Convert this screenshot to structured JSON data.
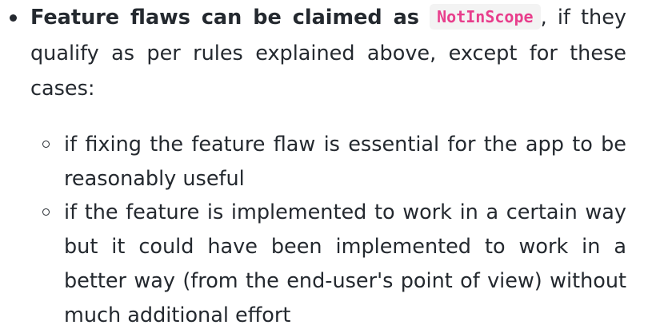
{
  "item": {
    "bold_text": "Feature flaws can be claimed as",
    "code": "NotInScope",
    "rest_text": ", if they qualify as per rules explained above, except for these cases:"
  },
  "subitems": [
    {
      "text": "if fixing the feature flaw is essential for the app to be reasonably useful"
    },
    {
      "text": "if the feature is implemented to work in a certain way but it could have been implemented to work in a better way (from the end-user's point of view) without much additional effort"
    }
  ],
  "icons": {
    "bullet": "filled-disc-bullet-icon",
    "sub_bullet": "hollow-circle-bullet-icon"
  },
  "colors": {
    "text": "#24292f",
    "code_text": "#e83e8c",
    "code_background": "#f3f3f3"
  }
}
